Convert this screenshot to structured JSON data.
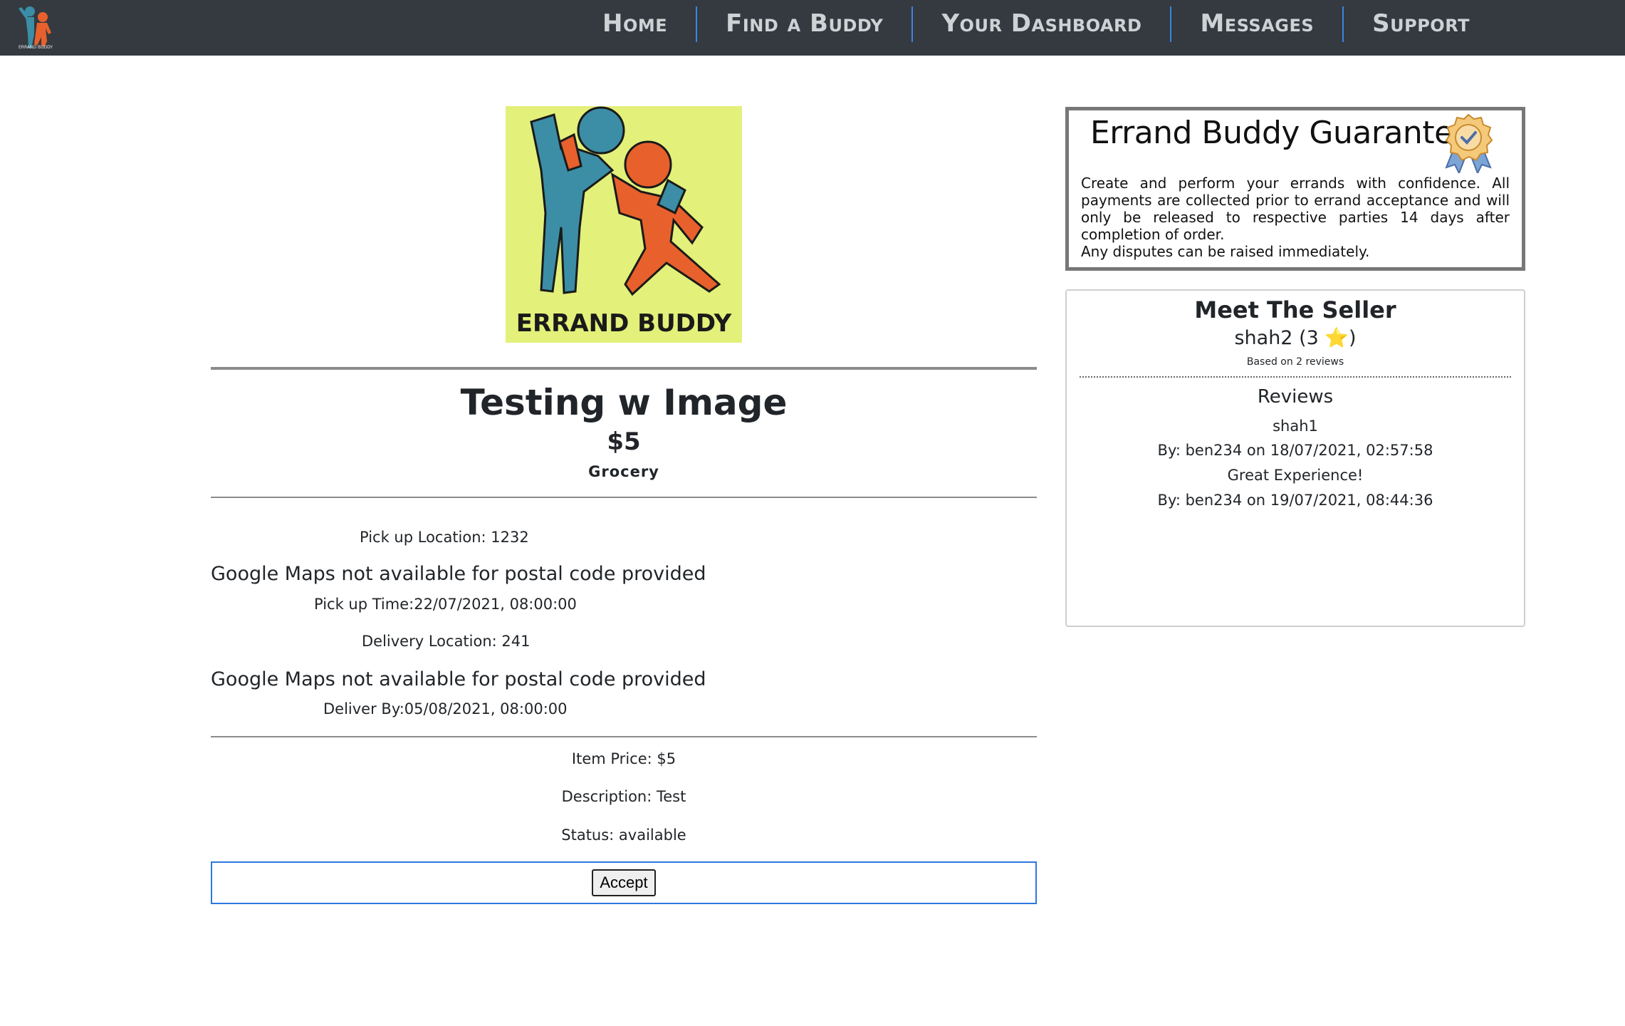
{
  "nav": {
    "logo_text": "ERRAND BUDDY",
    "items": [
      {
        "label": "Home"
      },
      {
        "label": "Find a Buddy"
      },
      {
        "label": "Your Dashboard"
      },
      {
        "label": "Messages"
      },
      {
        "label": "Support"
      }
    ]
  },
  "hero": {
    "logo_text": "ERRAND BUDDY",
    "background_color": "#e3f07a",
    "figure_left_color": "#3b8ea5",
    "figure_right_color": "#e8602c"
  },
  "errand": {
    "title": "Testing w Image",
    "price": "$5",
    "category": "Grocery",
    "pickup_location": "Pick up Location: 1232",
    "map_unavailable_1": "Google Maps not available for postal code provided",
    "pickup_time": "Pick up Time:22/07/2021, 08:00:00",
    "delivery_location": "Delivery Location: 241",
    "map_unavailable_2": "Google Maps not available for postal code provided",
    "deliver_by": "Deliver By:05/08/2021, 08:00:00",
    "item_price": "Item Price: $5",
    "description": "Description: Test",
    "status": "Status: available",
    "accept_label": "Accept"
  },
  "guarantee": {
    "title": "Errand Buddy Guarantee",
    "text": "Create and perform your errands with confidence. All payments are collected prior to errand acceptance and will only be released to respective parties 14 days after completion of order.",
    "text2": "Any disputes can be raised immediately."
  },
  "seller": {
    "heading": "Meet The Seller",
    "name_rating": "shah2 (3 ⭐)",
    "based_on": "Based on 2 reviews",
    "reviews_heading": "Reviews",
    "reviews": [
      {
        "comment": "shah1",
        "by": "By: ben234 on 18/07/2021, 02:57:58"
      },
      {
        "comment": "Great Experience!",
        "by": "By: ben234 on 19/07/2021, 08:44:36"
      }
    ]
  }
}
